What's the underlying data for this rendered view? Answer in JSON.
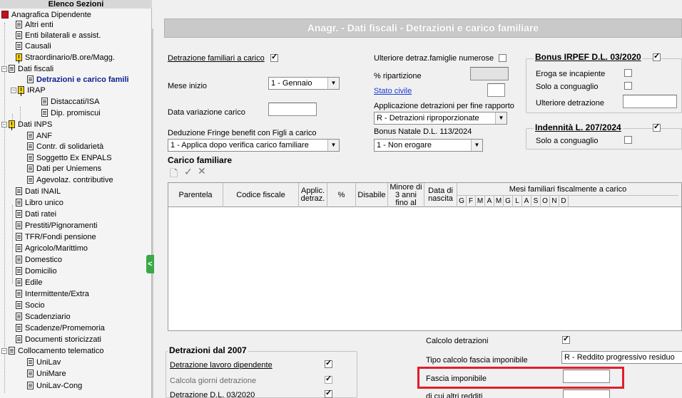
{
  "tree": {
    "header": "Elenco Sezioni",
    "items": [
      {
        "label": "Anagrafica Dipendente"
      },
      {
        "label": "Altri enti"
      },
      {
        "label": "Enti bilaterali e assist."
      },
      {
        "label": "Causali"
      },
      {
        "label": "Straordinario/B.ore/Magg."
      },
      {
        "label": "Dati fiscali"
      },
      {
        "label": "Detrazioni e carico famili"
      },
      {
        "label": "IRAP"
      },
      {
        "label": "Distaccati/ISA"
      },
      {
        "label": "Dip. promiscui"
      },
      {
        "label": "Dati INPS"
      },
      {
        "label": "ANF"
      },
      {
        "label": "Contr. di solidarietà"
      },
      {
        "label": "Soggetto Ex ENPALS"
      },
      {
        "label": "Dati per Uniemens"
      },
      {
        "label": "Agevolaz. contributive"
      },
      {
        "label": "Dati INAIL"
      },
      {
        "label": "Libro unico"
      },
      {
        "label": "Dati ratei"
      },
      {
        "label": "Prestiti/Pignoramenti"
      },
      {
        "label": "TFR/Fondi pensione"
      },
      {
        "label": "Agricolo/Marittimo"
      },
      {
        "label": "Domestico"
      },
      {
        "label": "Domicilio"
      },
      {
        "label": "Edile"
      },
      {
        "label": "Intermittente/Extra"
      },
      {
        "label": "Socio"
      },
      {
        "label": "Scadenziario"
      },
      {
        "label": "Scadenze/Promemoria"
      },
      {
        "label": "Documenti storicizzati"
      },
      {
        "label": "Collocamento telematico"
      },
      {
        "label": "UniLav"
      },
      {
        "label": "UniMare"
      },
      {
        "label": "UniLav-Cong"
      }
    ],
    "collapse_glyph": "<"
  },
  "title": "Anagr. - Dati fiscali - Detrazioni e carico familiare",
  "left_form": {
    "detrazione_familiari": "Detrazione familiari a carico",
    "mese_inizio": "Mese inizio",
    "mese_inizio_value": "1 - Gennaio",
    "data_variazione": "Data variazione carico",
    "deduzione_fringe": "Deduzione Fringe benefit con Figli a carico",
    "deduzione_fringe_value": "1 - Applica dopo verifica carico familiare"
  },
  "mid_form": {
    "ulteriore_detraz": "Ulteriore detraz.famiglie numerose",
    "ripartizione": "% ripartizione",
    "stato_civile": "Stato civile",
    "applicazione_detrazioni": "Applicazione detrazioni per fine rapporto",
    "applicazione_value": "R - Detrazioni riproporzionate",
    "bonus_natale": "Bonus Natale D.L. 113/2024",
    "bonus_natale_value": "1 - Non erogare"
  },
  "bonus_irpef": {
    "title": "Bonus IRPEF D.L. 03/2020",
    "eroga": "Eroga se incapiente",
    "solo_conguaglio": "Solo a conguaglio",
    "ulteriore": "Ulteriore detrazione"
  },
  "indennita": {
    "title": "Indennità L. 207/2024",
    "solo_conguaglio": "Solo a conguaglio"
  },
  "carico": {
    "title": "Carico familiare",
    "columns": [
      "Parentela",
      "Codice fiscale",
      "Applic. detraz.",
      "%",
      "Disabile",
      "Minore di 3 anni fino al",
      "Data di nascita"
    ],
    "months_header": "Mesi familiari fiscalmente a carico",
    "months": [
      "G",
      "F",
      "M",
      "A",
      "M",
      "G",
      "L",
      "A",
      "S",
      "O",
      "N",
      "D"
    ]
  },
  "detrazioni_2007": {
    "title": "Detrazioni dal 2007",
    "lavoro": "Detrazione lavoro dipendente",
    "giorni": "Calcola giorni detrazione",
    "dl03": "Detrazione D.L. 03/2020"
  },
  "calcolo": {
    "calcolo_detrazioni": "Calcolo detrazioni",
    "tipo_calcolo": "Tipo calcolo fascia imponibile",
    "tipo_calcolo_value": "R - Reddito progressivo residuo",
    "fascia": "Fascia imponibile",
    "altri_redditi": "di cui altri redditi"
  }
}
